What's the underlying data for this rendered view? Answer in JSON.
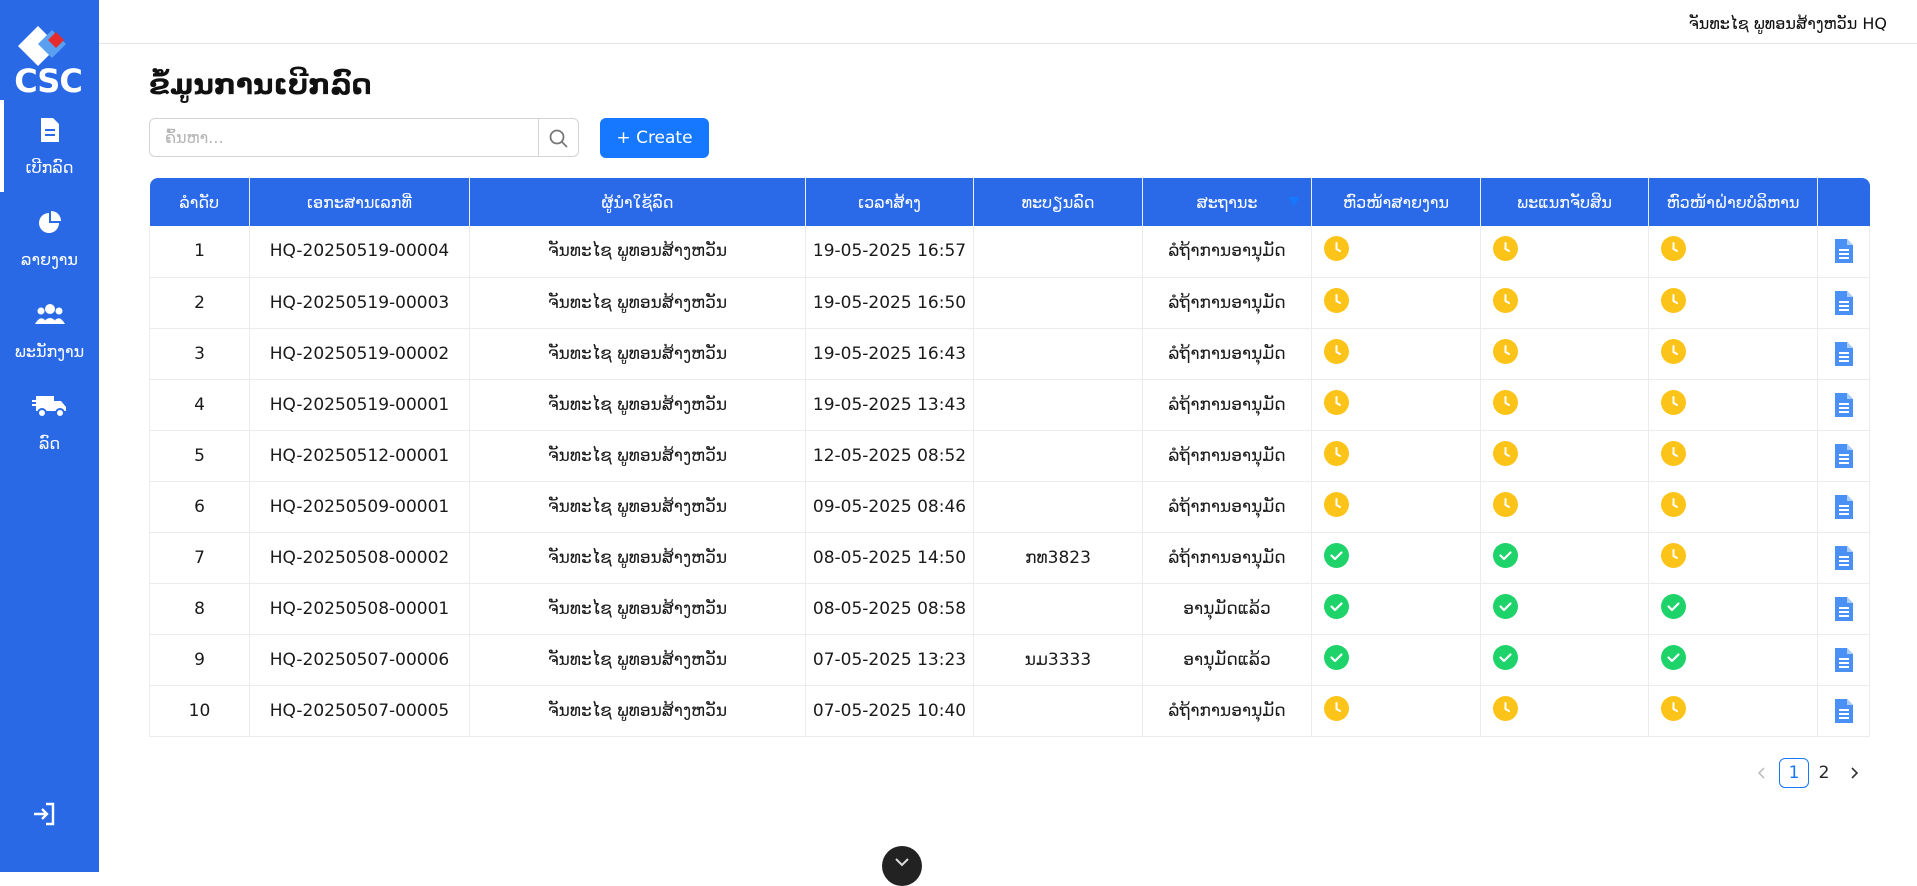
{
  "app": {
    "logo_text": "CSC"
  },
  "colors": {
    "sidebar": "#2969e6",
    "header": "#2a6ae8",
    "accent": "#1677ff",
    "pending": "#f5a800",
    "approved": "#1f4fd1",
    "clock": "#fcc419",
    "check": "#1dd36a"
  },
  "sidebar": {
    "items": [
      {
        "label": "ເບີກລົດ",
        "icon": "document-icon",
        "active": true
      },
      {
        "label": "ລາຍງານ",
        "icon": "pie-chart-icon",
        "active": false
      },
      {
        "label": "ພະນັກງານ",
        "icon": "users-icon",
        "active": false
      },
      {
        "label": "ລົດ",
        "icon": "truck-icon",
        "active": false
      }
    ],
    "logout_icon": "logout-icon"
  },
  "header": {
    "user_name": "ຈັນທະໄຊ ພູທອນສ້າງຫວັນ HQ"
  },
  "main": {
    "title": "ຂໍ້ມູນການເບີກລົດ",
    "search": {
      "placeholder": "ຄົ້ນຫາ...",
      "value": ""
    },
    "create_label": "+ Create"
  },
  "table": {
    "columns": [
      "ລຳດັບ",
      "ເອກະສານເລກທີ່",
      "ຜູ້ນຳໃຊ້ລົດ",
      "ເວລາສ້າງ",
      "ທະບຽນລົດ",
      "ສະຖານະ",
      "ຫົວໜ້າສາຍງານ",
      "ພະແນກຈັບສິນ",
      "ຫົວໜ້າຝ່າຍບໍລິຫານ",
      ""
    ],
    "rows": [
      {
        "no": "1",
        "doc": "HQ-20250519-00004",
        "user": "ຈັນທະໄຊ ພູທອນສ້າງຫວັນ",
        "time": "19-05-2025 16:57",
        "plate": "",
        "status": "ລໍຖ້າການອານຸມັດ",
        "status_type": "pending",
        "a1": "clock",
        "a2": "clock",
        "a3": "clock"
      },
      {
        "no": "2",
        "doc": "HQ-20250519-00003",
        "user": "ຈັນທະໄຊ ພູທອນສ້າງຫວັນ",
        "time": "19-05-2025 16:50",
        "plate": "",
        "status": "ລໍຖ້າການອານຸມັດ",
        "status_type": "pending",
        "a1": "clock",
        "a2": "clock",
        "a3": "clock"
      },
      {
        "no": "3",
        "doc": "HQ-20250519-00002",
        "user": "ຈັນທະໄຊ ພູທອນສ້າງຫວັນ",
        "time": "19-05-2025 16:43",
        "plate": "",
        "status": "ລໍຖ້າການອານຸມັດ",
        "status_type": "pending",
        "a1": "clock",
        "a2": "clock",
        "a3": "clock"
      },
      {
        "no": "4",
        "doc": "HQ-20250519-00001",
        "user": "ຈັນທະໄຊ ພູທອນສ້າງຫວັນ",
        "time": "19-05-2025 13:43",
        "plate": "",
        "status": "ລໍຖ້າການອານຸມັດ",
        "status_type": "pending",
        "a1": "clock",
        "a2": "clock",
        "a3": "clock"
      },
      {
        "no": "5",
        "doc": "HQ-20250512-00001",
        "user": "ຈັນທະໄຊ ພູທອນສ້າງຫວັນ",
        "time": "12-05-2025 08:52",
        "plate": "",
        "status": "ລໍຖ້າການອານຸມັດ",
        "status_type": "pending",
        "a1": "clock",
        "a2": "clock",
        "a3": "clock"
      },
      {
        "no": "6",
        "doc": "HQ-20250509-00001",
        "user": "ຈັນທະໄຊ ພູທອນສ້າງຫວັນ",
        "time": "09-05-2025 08:46",
        "plate": "",
        "status": "ລໍຖ້າການອານຸມັດ",
        "status_type": "pending",
        "a1": "clock",
        "a2": "clock",
        "a3": "clock"
      },
      {
        "no": "7",
        "doc": "HQ-20250508-00002",
        "user": "ຈັນທະໄຊ ພູທອນສ້າງຫວັນ",
        "time": "08-05-2025 14:50",
        "plate": "ກທ3823",
        "status": "ລໍຖ້າການອານຸມັດ",
        "status_type": "pending",
        "a1": "check",
        "a2": "check",
        "a3": "clock"
      },
      {
        "no": "8",
        "doc": "HQ-20250508-00001",
        "user": "ຈັນທະໄຊ ພູທອນສ້າງຫວັນ",
        "time": "08-05-2025 08:58",
        "plate": "",
        "status": "ອານຸມັດແລ້ວ",
        "status_type": "approved",
        "a1": "check",
        "a2": "check",
        "a3": "check"
      },
      {
        "no": "9",
        "doc": "HQ-20250507-00006",
        "user": "ຈັນທະໄຊ ພູທອນສ້າງຫວັນ",
        "time": "07-05-2025 13:23",
        "plate": "ນມ3333",
        "status": "ອານຸມັດແລ້ວ",
        "status_type": "approved",
        "a1": "check",
        "a2": "check",
        "a3": "check"
      },
      {
        "no": "10",
        "doc": "HQ-20250507-00005",
        "user": "ຈັນທະໄຊ ພູທອນສ້າງຫວັນ",
        "time": "07-05-2025 10:40",
        "plate": "",
        "status": "ລໍຖ້າການອານຸມັດ",
        "status_type": "pending",
        "a1": "clock",
        "a2": "clock",
        "a3": "clock"
      }
    ]
  },
  "pagination": {
    "current": "1",
    "pages": [
      "1",
      "2"
    ]
  }
}
